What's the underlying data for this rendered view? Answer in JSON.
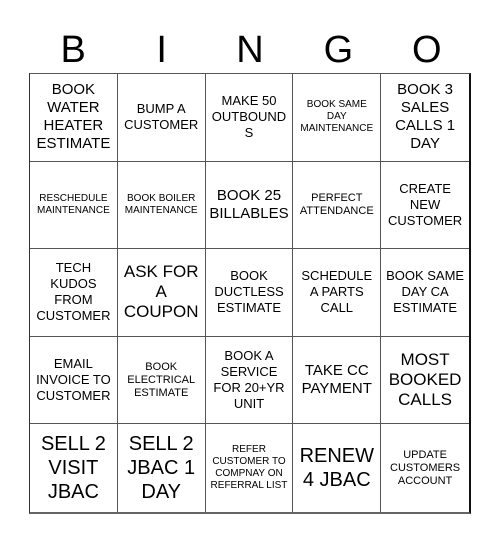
{
  "title_letters": [
    "B",
    "I",
    "N",
    "G",
    "O"
  ],
  "cells": [
    {
      "text": "BOOK WATER HEATER ESTIMATE",
      "size": "m"
    },
    {
      "text": "BUMP A CUSTOMER",
      "size": "s"
    },
    {
      "text": "MAKE 50 OUTBOUNDS",
      "size": "s"
    },
    {
      "text": "BOOK SAME DAY MAINTENANCE",
      "size": "xxs"
    },
    {
      "text": "BOOK 3 SALES CALLS 1 DAY",
      "size": "m"
    },
    {
      "text": "RESCHEDULE MAINTENANCE",
      "size": "xxs"
    },
    {
      "text": "BOOK BOILER MAINTENANCE",
      "size": "xxs"
    },
    {
      "text": "BOOK 25 BILLABLES",
      "size": "m"
    },
    {
      "text": "PERFECT ATTENDANCE",
      "size": "xs"
    },
    {
      "text": "CREATE NEW CUSTOMER",
      "size": "s"
    },
    {
      "text": "TECH KUDOS FROM CUSTOMER",
      "size": "s"
    },
    {
      "text": "ASK FOR A COUPON",
      "size": "l"
    },
    {
      "text": "BOOK DUCTLESS ESTIMATE",
      "size": "s"
    },
    {
      "text": "SCHEDULE A PARTS CALL",
      "size": "s"
    },
    {
      "text": "BOOK SAME DAY CA ESTIMATE",
      "size": "s"
    },
    {
      "text": "EMAIL INVOICE TO CUSTOMER",
      "size": "s"
    },
    {
      "text": "BOOK ELECTRICAL ESTIMATE",
      "size": "xs"
    },
    {
      "text": "BOOK A SERVICE FOR 20+YR UNIT",
      "size": "s"
    },
    {
      "text": "TAKE CC PAYMENT",
      "size": "m"
    },
    {
      "text": "MOST BOOKED CALLS",
      "size": "l"
    },
    {
      "text": "SELL 2 VISIT JBAC",
      "size": "xl"
    },
    {
      "text": "SELL 2 JBAC 1 DAY",
      "size": "xl"
    },
    {
      "text": "REFER CUSTOMER TO COMPNAY ON REFERRAL LIST",
      "size": "xxs"
    },
    {
      "text": "RENEW 4 JBAC",
      "size": "xl"
    },
    {
      "text": "UPDATE CUSTOMERS ACCOUNT",
      "size": "xs"
    }
  ]
}
